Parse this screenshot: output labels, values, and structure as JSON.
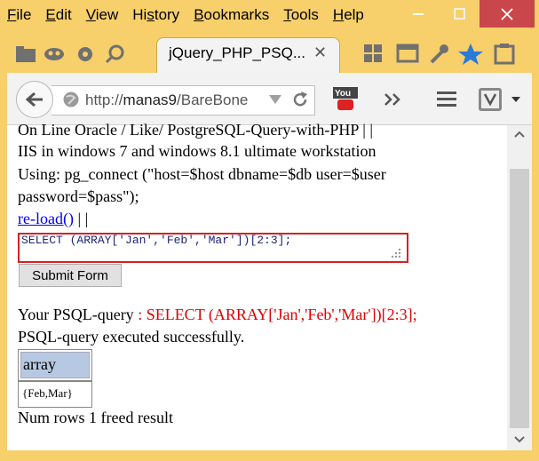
{
  "menu": {
    "items": [
      "File",
      "Edit",
      "View",
      "History",
      "Bookmarks",
      "Tools",
      "Help"
    ],
    "underline": [
      "F",
      "E",
      "V",
      "s",
      "B",
      "T",
      "H"
    ]
  },
  "tab": {
    "title": "jQuery_PHP_PSQ..."
  },
  "nav": {
    "url_prefix": "http://",
    "url_host": "manas9",
    "url_path": "/BareBone"
  },
  "page": {
    "line1": "On Line Oracle / Like/ PostgreSQL-Query-with-PHP | |",
    "line2": "IIS in windows 7 and windows 8.1 ultimate workstation",
    "line3": "Using: pg_connect (\"host=$host dbname=$db user=$user",
    "line4": "password=$pass\");",
    "reload_link": "re-load()",
    "reload_sep": " | |",
    "query_value": "SELECT (ARRAY['Jan','Feb','Mar'])[2:3];",
    "submit_label": "Submit Form",
    "your_query_label": "Your PSQL-query",
    "your_query_value": " : SELECT (ARRAY['Jan','Feb','Mar'])[2:3];",
    "status": "PSQL-query executed successfully.",
    "table_header": "array",
    "table_cell": "{Feb,Mar}",
    "footer": "Num rows 1 freed result"
  },
  "colors": {
    "accent": "#f7cf6b",
    "close": "#c9474a",
    "error": "#e00000",
    "link": "#0000ee"
  }
}
